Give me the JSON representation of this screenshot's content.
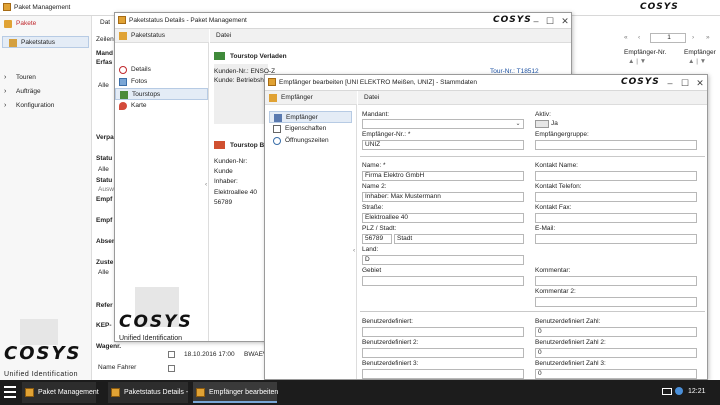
{
  "colors": {
    "accent_red": "#c0282d",
    "taskbar": "#1c1c1c",
    "selection": "#e4ecf6"
  },
  "main": {
    "title": "Paket Management",
    "sidebar": {
      "pakete": "Pakete",
      "paketstatus": "Paketstatus",
      "touren": "Touren",
      "auftraege": "Aufträge",
      "konfiguration": "Konfiguration"
    },
    "frags": {
      "dat": "Dat",
      "zeilen": "Zeilen",
      "mand": "Mand",
      "erfas": "Erfas",
      "alle1": "Alle",
      "verpa": "Verpa",
      "status": "Statu",
      "alle2": "Alle",
      "statu2": "Statu",
      "auswa": "Auswa",
      "empf1": "Empf",
      "empf2": "Empf",
      "absen": "Absen",
      "zuste": "Zuste",
      "alle3": "Alle",
      "refer": "Refer",
      "kep": "KEP-",
      "wagen": "Wagenr.",
      "name_fahrer": "Name Fahrer"
    },
    "right": {
      "page": "1",
      "col1": "Empfänger-Nr.",
      "col2": "Empfänger"
    },
    "row": {
      "date": "18.10.2016 17:00",
      "code": "BWAEV"
    },
    "brand_tagline": "Unified Identification",
    "brand": "COSYS"
  },
  "paketstatus": {
    "title": "Paketstatus Details - Paket Management",
    "nav_header": "Paketstatus",
    "menu": "Datei",
    "nav": {
      "details": "Details",
      "fotos": "Fotos",
      "tourstops": "Tourstops",
      "karte": "Karte"
    },
    "tourstop_verladen": "Tourstop Verladen",
    "kunden_nr": "Kunden-Nr.: ENSO-Z",
    "kunden_nr_value": "ENSO-Z",
    "kunde_betrieb": "Kunde: Betriebsh",
    "tour_nr": "Tour-Nr.: T18512",
    "tourstop_b": "Tourstop B",
    "kunden_nr2": "Kunden-Nr:",
    "kunde": "Kunde",
    "inhaber": "Inhaber:",
    "strasse": "Elektroallee 40",
    "plz": "56789",
    "brand_tagline": "Unified Identification"
  },
  "empfaenger": {
    "title": "Empfänger bearbeiten [UNI ELEKTRO Meißen, UNIZ] - Stammdaten",
    "nav_header": "Empfänger",
    "menu": "Datei",
    "nav": {
      "empfaenger": "Empfänger",
      "eigenschaften": "Eigenschaften",
      "oeffnungszeiten": "Öffnungszeiten"
    },
    "fields": {
      "mandant_label": "Mandant:",
      "mandant_value": "",
      "aktiv_label": "Aktiv:",
      "aktiv_value": "Ja",
      "empf_nr_label": "Empfänger-Nr.: *",
      "empf_nr_value": "UNIZ",
      "empf_gruppe_label": "Empfängergruppe:",
      "empf_gruppe_value": "",
      "name_label": "Name: *",
      "name_value": "Firma Elektro GmbH",
      "name2_label": "Name 2:",
      "name2_value": "Inhaber: Max Mustermann",
      "strasse_label": "Straße:",
      "strasse_value": "Elektroallee 40",
      "plz_label": "PLZ / Stadt:",
      "plz_value": "56789",
      "stadt_value": "Stadt",
      "land_label": "Land:",
      "land_value": "D",
      "gebiet_label": "Gebiet",
      "gebiet_value": "",
      "kontakt_name_label": "Kontakt Name:",
      "kontakt_telefon_label": "Kontakt Telefon:",
      "kontakt_fax_label": "Kontakt Fax:",
      "email_label": "E-Mail:",
      "kommentar_label": "Kommentar:",
      "kommentar2_label": "Kommentar 2:",
      "bdef_label": "Benutzerdefiniert:",
      "bdef2_label": "Benutzerdefiniert 2:",
      "bdef3_label": "Benutzerdefiniert 3:",
      "bzahl_label": "Benutzerdefiniert Zahl:",
      "bzahl_value": "0",
      "bzahl2_label": "Benutzerdefiniert Zahl 2:",
      "bzahl2_value": "0",
      "bzahl3_label": "Benutzerdefiniert Zahl 3:",
      "bzahl3_value": "0"
    }
  },
  "taskbar": {
    "app1": "Paket Management",
    "app2": "Paketstatus Details -",
    "app3": "Empfänger bearbeiten",
    "clock": "12:21"
  }
}
